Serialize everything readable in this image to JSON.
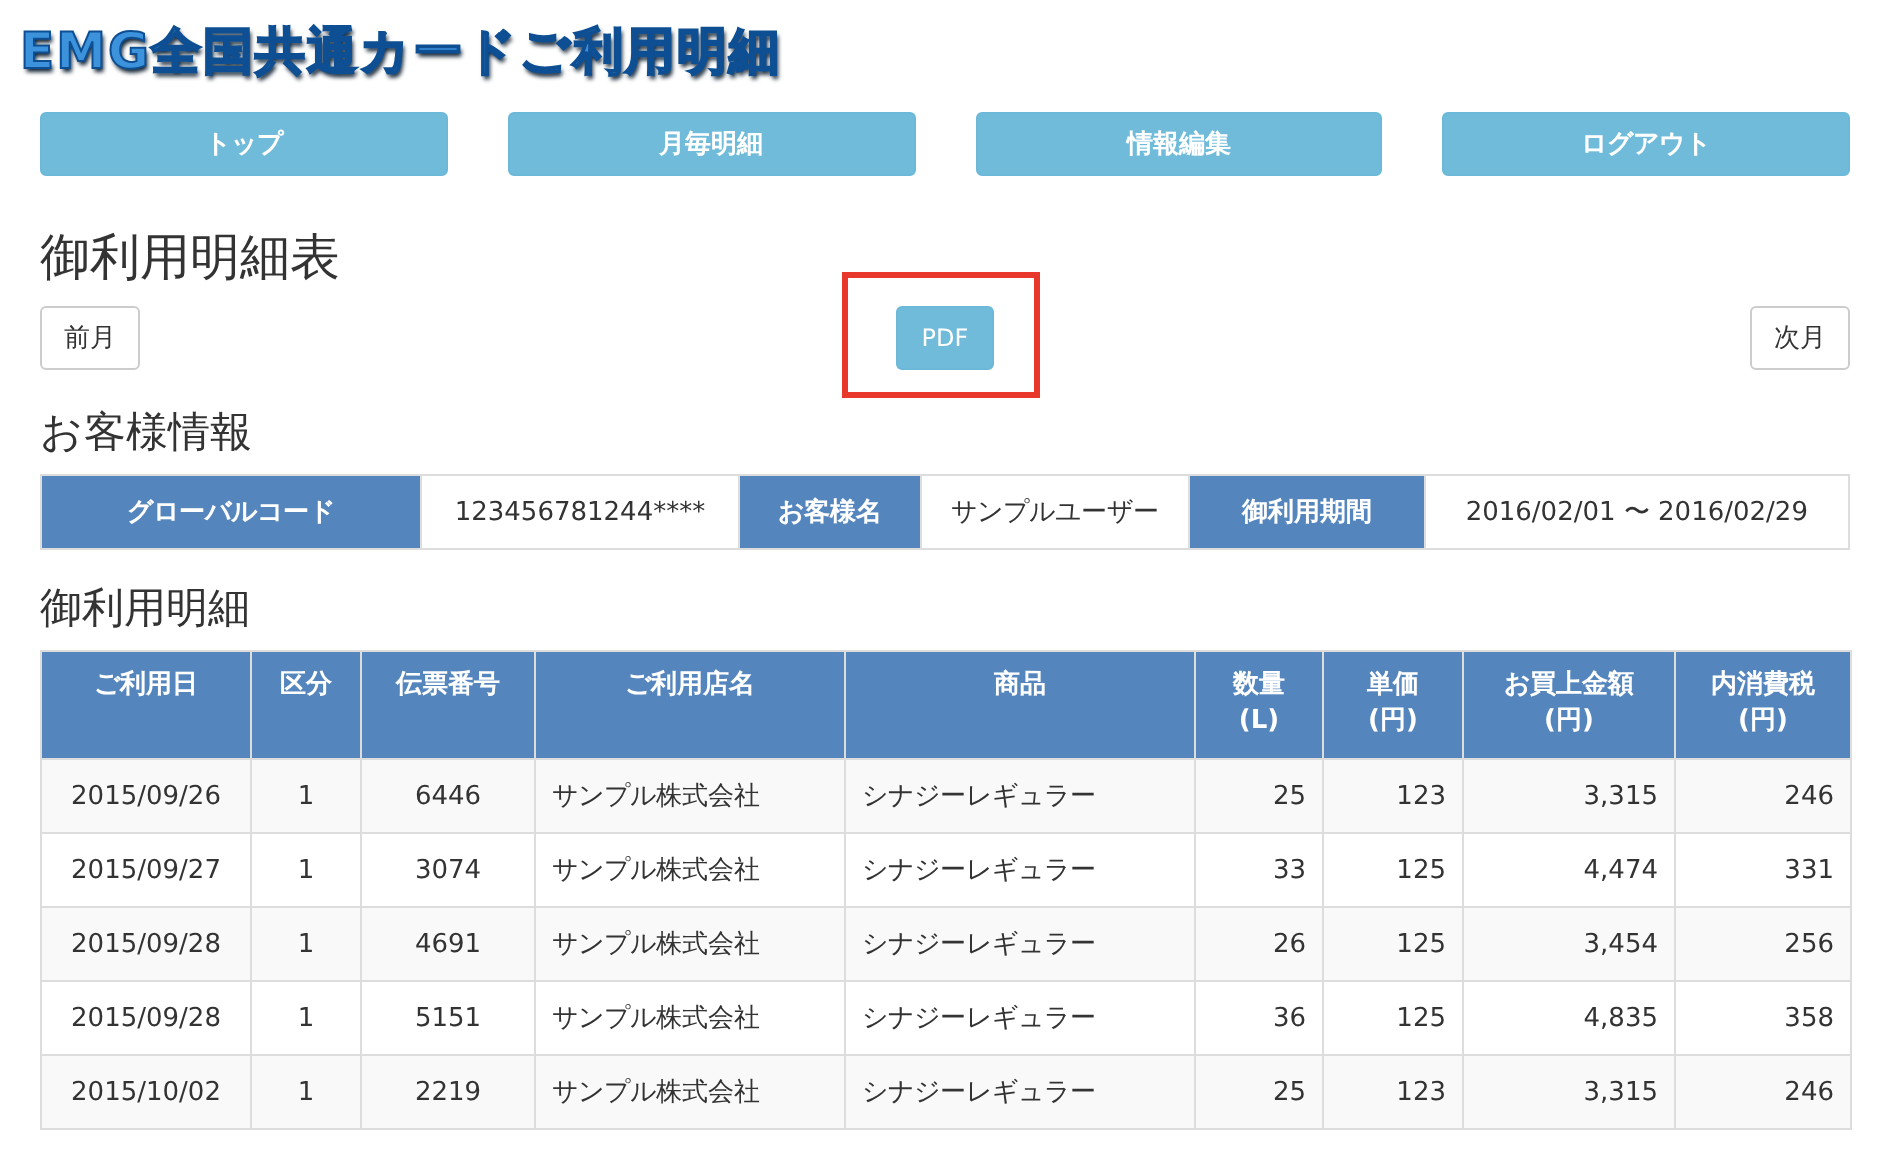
{
  "logo": "EMG全国共通カードご利用明細",
  "nav": [
    {
      "label": "トップ"
    },
    {
      "label": "月毎明細"
    },
    {
      "label": "情報編集"
    },
    {
      "label": "ログアウト"
    }
  ],
  "page_title": "御利用明細表",
  "month_nav": {
    "prev": "前月",
    "pdf": "PDF",
    "next": "次月",
    "pdf_highlighted": true
  },
  "customer_section": {
    "heading": "お客様情報",
    "fields": [
      {
        "label": "グローバルコード",
        "value": "123456781244****"
      },
      {
        "label": "お客様名",
        "value": "サンプルユーザー"
      },
      {
        "label": "御利用期間",
        "value": "2016/02/01 〜 2016/02/29"
      }
    ]
  },
  "detail_section": {
    "heading": "御利用明細",
    "columns": [
      "ご利用日",
      "区分",
      "伝票番号",
      "ご利用店名",
      "商品",
      "数量\n(L)",
      "単価\n(円)",
      "お買上金額\n(円)",
      "内消費税\n(円)"
    ],
    "rows": [
      [
        "2015/09/26",
        "1",
        "6446",
        "サンプル株式会社",
        "シナジーレギュラー",
        "25",
        "123",
        "3,315",
        "246"
      ],
      [
        "2015/09/27",
        "1",
        "3074",
        "サンプル株式会社",
        "シナジーレギュラー",
        "33",
        "125",
        "4,474",
        "331"
      ],
      [
        "2015/09/28",
        "1",
        "4691",
        "サンプル株式会社",
        "シナジーレギュラー",
        "26",
        "125",
        "3,454",
        "256"
      ],
      [
        "2015/09/28",
        "1",
        "5151",
        "サンプル株式会社",
        "シナジーレギュラー",
        "36",
        "125",
        "4,835",
        "358"
      ],
      [
        "2015/10/02",
        "1",
        "2219",
        "サンプル株式会社",
        "シナジーレギュラー",
        "25",
        "123",
        "3,315",
        "246"
      ]
    ]
  }
}
